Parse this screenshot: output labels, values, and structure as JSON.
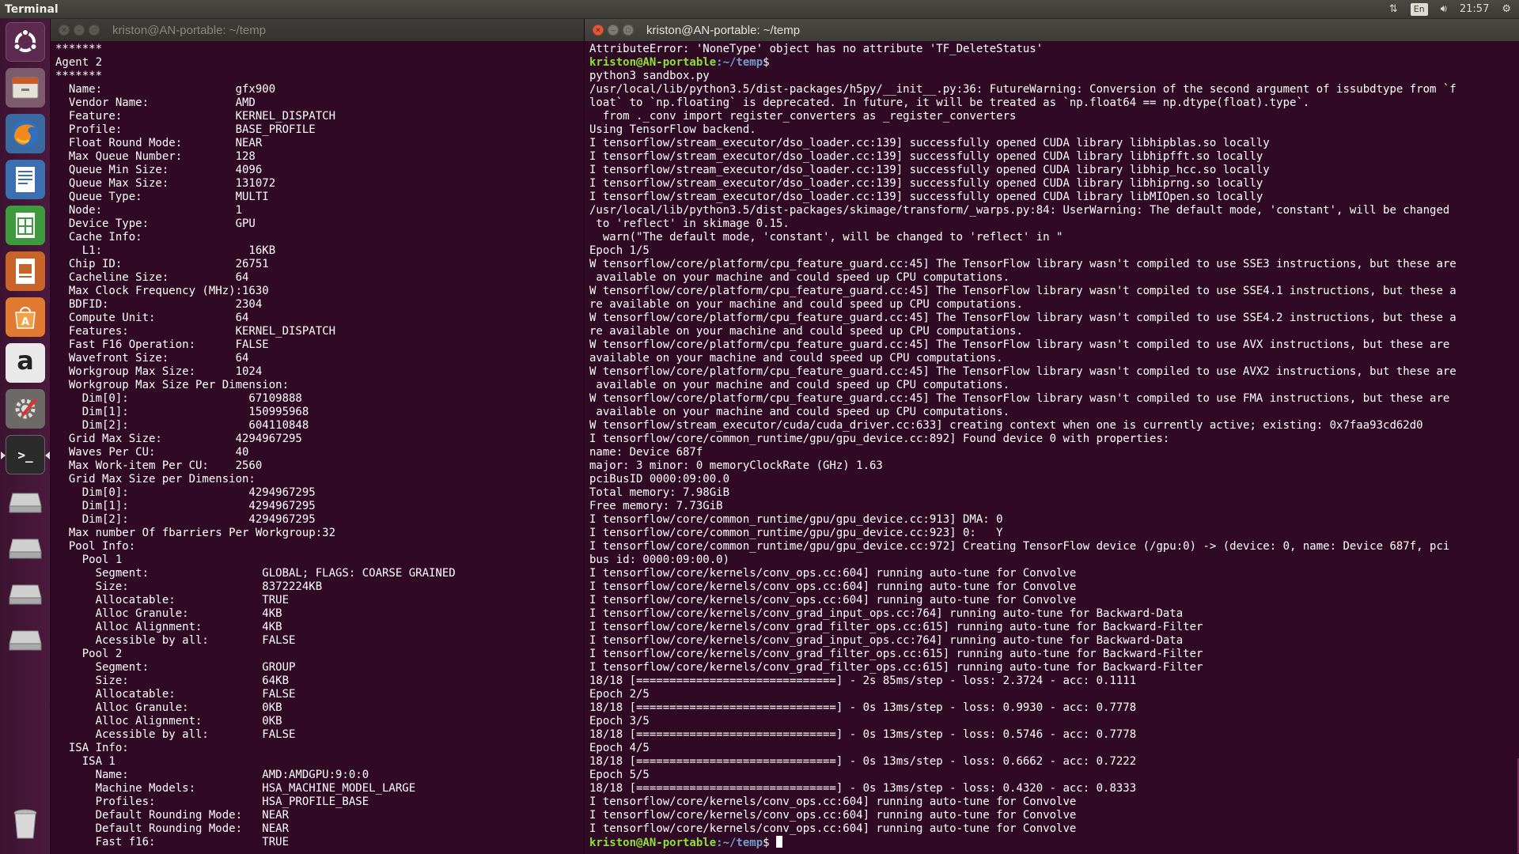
{
  "top_panel": {
    "app_title": "Terminal",
    "language": "En",
    "time": "21:57"
  },
  "launcher": {
    "items": [
      {
        "name": "dash",
        "icon": "ubuntu-logo-icon"
      },
      {
        "name": "files",
        "icon": "file-cabinet-icon"
      },
      {
        "name": "firefox",
        "icon": "firefox-icon"
      },
      {
        "name": "writer",
        "icon": "libreoffice-writer-icon"
      },
      {
        "name": "calc",
        "icon": "libreoffice-calc-icon"
      },
      {
        "name": "impress",
        "icon": "libreoffice-impress-icon"
      },
      {
        "name": "software",
        "icon": "software-center-icon"
      },
      {
        "name": "amazon",
        "icon": "amazon-icon",
        "label": "a"
      },
      {
        "name": "settings",
        "icon": "system-settings-icon"
      },
      {
        "name": "terminal",
        "icon": "terminal-icon",
        "label": ">_"
      },
      {
        "name": "drive-1",
        "icon": "drive-icon"
      },
      {
        "name": "drive-2",
        "icon": "drive-icon"
      },
      {
        "name": "drive-3",
        "icon": "drive-icon"
      },
      {
        "name": "drive-4",
        "icon": "drive-icon"
      },
      {
        "name": "trash",
        "icon": "trash-icon"
      }
    ]
  },
  "left_terminal": {
    "title": "kriston@AN-portable: ~/temp",
    "lines": [
      "*******",
      "Agent 2",
      "*******",
      "  Name:                    gfx900",
      "  Vendor Name:             AMD",
      "  Feature:                 KERNEL_DISPATCH",
      "  Profile:                 BASE_PROFILE",
      "  Float Round Mode:        NEAR",
      "  Max Queue Number:        128",
      "  Queue Min Size:          4096",
      "  Queue Max Size:          131072",
      "  Queue Type:              MULTI",
      "  Node:                    1",
      "  Device Type:             GPU",
      "  Cache Info:",
      "    L1:                      16KB",
      "  Chip ID:                 26751",
      "  Cacheline Size:          64",
      "  Max Clock Frequency (MHz):1630",
      "  BDFID:                   2304",
      "  Compute Unit:            64",
      "  Features:                KERNEL_DISPATCH",
      "  Fast F16 Operation:      FALSE",
      "  Wavefront Size:          64",
      "  Workgroup Max Size:      1024",
      "  Workgroup Max Size Per Dimension:",
      "    Dim[0]:                  67109888",
      "    Dim[1]:                  150995968",
      "    Dim[2]:                  604110848",
      "  Grid Max Size:           4294967295",
      "  Waves Per CU:            40",
      "  Max Work-item Per CU:    2560",
      "  Grid Max Size per Dimension:",
      "    Dim[0]:                  4294967295",
      "    Dim[1]:                  4294967295",
      "    Dim[2]:                  4294967295",
      "  Max number Of fbarriers Per Workgroup:32",
      "  Pool Info:",
      "    Pool 1",
      "      Segment:                 GLOBAL; FLAGS: COARSE GRAINED",
      "      Size:                    8372224KB",
      "      Allocatable:             TRUE",
      "      Alloc Granule:           4KB",
      "      Alloc Alignment:         4KB",
      "      Acessible by all:        FALSE",
      "    Pool 2",
      "      Segment:                 GROUP",
      "      Size:                    64KB",
      "      Allocatable:             FALSE",
      "      Alloc Granule:           0KB",
      "      Alloc Alignment:         0KB",
      "      Acessible by all:        FALSE",
      "  ISA Info:",
      "    ISA 1",
      "      Name:                    AMD:AMDGPU:9:0:0",
      "      Machine Models:          HSA_MACHINE_MODEL_LARGE",
      "      Profiles:                HSA_PROFILE_BASE",
      "      Default Rounding Mode:   NEAR",
      "      Default Rounding Mode:   NEAR",
      "      Fast f16:                TRUE"
    ]
  },
  "right_terminal": {
    "title": "kriston@AN-portable: ~/temp",
    "prompt_user": "kriston@AN-portable",
    "prompt_path": ":~/temp",
    "prompt_sign": "$",
    "lines": [
      {
        "t": "AttributeError: 'NoneType' object has no attribute 'TF_DeleteStatus'"
      },
      {
        "prompt": true,
        "t": ""
      },
      {
        "t": "python3 sandbox.py"
      },
      {
        "t": "/usr/local/lib/python3.5/dist-packages/h5py/__init__.py:36: FutureWarning: Conversion of the second argument of issubdtype from `f"
      },
      {
        "t": "loat` to `np.floating` is deprecated. In future, it will be treated as `np.float64 == np.dtype(float).type`."
      },
      {
        "t": "  from ._conv import register_converters as _register_converters"
      },
      {
        "t": "Using TensorFlow backend."
      },
      {
        "t": "I tensorflow/stream_executor/dso_loader.cc:139] successfully opened CUDA library libhipblas.so locally"
      },
      {
        "t": "I tensorflow/stream_executor/dso_loader.cc:139] successfully opened CUDA library libhipfft.so locally"
      },
      {
        "t": "I tensorflow/stream_executor/dso_loader.cc:139] successfully opened CUDA library libhip_hcc.so locally"
      },
      {
        "t": "I tensorflow/stream_executor/dso_loader.cc:139] successfully opened CUDA library libhiprng.so locally"
      },
      {
        "t": "I tensorflow/stream_executor/dso_loader.cc:139] successfully opened CUDA library libMIOpen.so locally"
      },
      {
        "t": "/usr/local/lib/python3.5/dist-packages/skimage/transform/_warps.py:84: UserWarning: The default mode, 'constant', will be changed"
      },
      {
        "t": " to 'reflect' in skimage 0.15."
      },
      {
        "t": "  warn(\"The default mode, 'constant', will be changed to 'reflect' in \""
      },
      {
        "t": "Epoch 1/5"
      },
      {
        "t": "W tensorflow/core/platform/cpu_feature_guard.cc:45] The TensorFlow library wasn't compiled to use SSE3 instructions, but these are"
      },
      {
        "t": " available on your machine and could speed up CPU computations."
      },
      {
        "t": "W tensorflow/core/platform/cpu_feature_guard.cc:45] The TensorFlow library wasn't compiled to use SSE4.1 instructions, but these a"
      },
      {
        "t": "re available on your machine and could speed up CPU computations."
      },
      {
        "t": "W tensorflow/core/platform/cpu_feature_guard.cc:45] The TensorFlow library wasn't compiled to use SSE4.2 instructions, but these a"
      },
      {
        "t": "re available on your machine and could speed up CPU computations."
      },
      {
        "t": "W tensorflow/core/platform/cpu_feature_guard.cc:45] The TensorFlow library wasn't compiled to use AVX instructions, but these are"
      },
      {
        "t": "available on your machine and could speed up CPU computations."
      },
      {
        "t": "W tensorflow/core/platform/cpu_feature_guard.cc:45] The TensorFlow library wasn't compiled to use AVX2 instructions, but these are"
      },
      {
        "t": " available on your machine and could speed up CPU computations."
      },
      {
        "t": "W tensorflow/core/platform/cpu_feature_guard.cc:45] The TensorFlow library wasn't compiled to use FMA instructions, but these are"
      },
      {
        "t": " available on your machine and could speed up CPU computations."
      },
      {
        "t": "W tensorflow/stream_executor/cuda/cuda_driver.cc:633] creating context when one is currently active; existing: 0x7faa93cd62d0"
      },
      {
        "t": "I tensorflow/core/common_runtime/gpu/gpu_device.cc:892] Found device 0 with properties:"
      },
      {
        "t": "name: Device 687f"
      },
      {
        "t": "major: 3 minor: 0 memoryClockRate (GHz) 1.63"
      },
      {
        "t": "pciBusID 0000:09:00.0"
      },
      {
        "t": "Total memory: 7.98GiB"
      },
      {
        "t": "Free memory: 7.73GiB"
      },
      {
        "t": "I tensorflow/core/common_runtime/gpu/gpu_device.cc:913] DMA: 0"
      },
      {
        "t": "I tensorflow/core/common_runtime/gpu/gpu_device.cc:923] 0:   Y"
      },
      {
        "t": "I tensorflow/core/common_runtime/gpu/gpu_device.cc:972] Creating TensorFlow device (/gpu:0) -> (device: 0, name: Device 687f, pci"
      },
      {
        "t": "bus id: 0000:09:00.0)"
      },
      {
        "t": "I tensorflow/core/kernels/conv_ops.cc:604] running auto-tune for Convolve"
      },
      {
        "t": "I tensorflow/core/kernels/conv_ops.cc:604] running auto-tune for Convolve"
      },
      {
        "t": "I tensorflow/core/kernels/conv_ops.cc:604] running auto-tune for Convolve"
      },
      {
        "t": "I tensorflow/core/kernels/conv_grad_input_ops.cc:764] running auto-tune for Backward-Data"
      },
      {
        "t": "I tensorflow/core/kernels/conv_grad_filter_ops.cc:615] running auto-tune for Backward-Filter"
      },
      {
        "t": "I tensorflow/core/kernels/conv_grad_input_ops.cc:764] running auto-tune for Backward-Data"
      },
      {
        "t": "I tensorflow/core/kernels/conv_grad_filter_ops.cc:615] running auto-tune for Backward-Filter"
      },
      {
        "t": "I tensorflow/core/kernels/conv_grad_filter_ops.cc:615] running auto-tune for Backward-Filter"
      },
      {
        "t": "18/18 [==============================] - 2s 85ms/step - loss: 2.3724 - acc: 0.1111"
      },
      {
        "t": "Epoch 2/5"
      },
      {
        "t": "18/18 [==============================] - 0s 13ms/step - loss: 0.9930 - acc: 0.7778"
      },
      {
        "t": "Epoch 3/5"
      },
      {
        "t": "18/18 [==============================] - 0s 13ms/step - loss: 0.5746 - acc: 0.7778"
      },
      {
        "t": "Epoch 4/5"
      },
      {
        "t": "18/18 [==============================] - 0s 13ms/step - loss: 0.6662 - acc: 0.7222"
      },
      {
        "t": "Epoch 5/5"
      },
      {
        "t": "18/18 [==============================] - 0s 13ms/step - loss: 0.4320 - acc: 0.8333"
      },
      {
        "t": "I tensorflow/core/kernels/conv_ops.cc:604] running auto-tune for Convolve"
      },
      {
        "t": "I tensorflow/core/kernels/conv_ops.cc:604] running auto-tune for Convolve"
      },
      {
        "t": "I tensorflow/core/kernels/conv_ops.cc:604] running auto-tune for Convolve"
      },
      {
        "prompt": true,
        "t": "",
        "cursor": true
      }
    ]
  },
  "colors": {
    "terminal_bg": "#300a24",
    "prompt_user": "#8ae234",
    "prompt_path": "#729fcf",
    "close_button": "#e25a3a"
  }
}
